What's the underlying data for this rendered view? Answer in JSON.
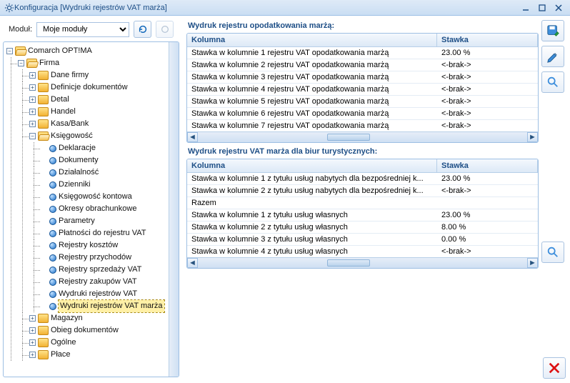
{
  "window": {
    "title": "Konfiguracja [Wydruki rejestrów VAT marża]"
  },
  "modulebar": {
    "label": "Moduł:",
    "selected": "Moje moduły"
  },
  "tree": {
    "root": "Comarch OPT!MA",
    "firma": "Firma",
    "dane_firmy": "Dane firmy",
    "definicje_dok": "Definicje dokumentów",
    "detal": "Detal",
    "handel": "Handel",
    "kasa_bank": "Kasa/Bank",
    "ksiegowosc": "Księgowość",
    "deklaracje": "Deklaracje",
    "dokumenty": "Dokumenty",
    "dzialalnosc": "Działalność",
    "dzienniki": "Dzienniki",
    "ksieg_kontowa": "Księgowość kontowa",
    "okresy": "Okresy obrachunkowe",
    "parametry": "Parametry",
    "platnosci": "Płatności do rejestru VAT",
    "rej_kosztow": "Rejestry kosztów",
    "rej_przych": "Rejestry przychodów",
    "rej_sprzed": "Rejestry sprzedaży VAT",
    "rej_zak": "Rejestry zakupów VAT",
    "wydruki_vat": "Wydruki rejestrów VAT",
    "wydruki_vat_m": "Wydruki rejestrów VAT marża",
    "magazyn": "Magazyn",
    "obieg": "Obieg dokumentów",
    "ogolne": "Ogólne",
    "place": "Płace"
  },
  "panel1": {
    "title": "Wydruk rejestru opodatkowania marżą:",
    "col_a": "Kolumna",
    "col_b": "Stawka",
    "rows": [
      {
        "a": "Stawka w kolumnie 1 rejestru VAT opodatkowania marżą",
        "b": "23.00 %"
      },
      {
        "a": "Stawka w kolumnie 2 rejestru VAT opodatkowania marżą",
        "b": "<-brak->"
      },
      {
        "a": "Stawka w kolumnie 3 rejestru VAT opodatkowania marżą",
        "b": "<-brak->"
      },
      {
        "a": "Stawka w kolumnie 4 rejestru VAT opodatkowania marżą",
        "b": "<-brak->"
      },
      {
        "a": "Stawka w kolumnie 5 rejestru VAT opodatkowania marżą",
        "b": "<-brak->"
      },
      {
        "a": "Stawka w kolumnie 6 rejestru VAT opodatkowania marżą",
        "b": "<-brak->"
      },
      {
        "a": "Stawka w kolumnie 7 rejestru VAT opodatkowania marżą",
        "b": "<-brak->"
      }
    ]
  },
  "panel2": {
    "title": "Wydruk rejestru VAT marża dla biur turystycznych:",
    "col_a": "Kolumna",
    "col_b": "Stawka",
    "rows": [
      {
        "a": "Stawka w kolumnie 1 z tytułu usług nabytych dla bezpośredniej k...",
        "b": "23.00 %"
      },
      {
        "a": "Stawka w kolumnie 2 z tytułu usług nabytych dla bezpośredniej k...",
        "b": "<-brak->"
      },
      {
        "a": "Razem",
        "b": ""
      },
      {
        "a": "Stawka w kolumnie 1 z tytułu usług własnych",
        "b": "23.00 %"
      },
      {
        "a": "Stawka w kolumnie 2 z tytułu usług własnych",
        "b": "8.00  %"
      },
      {
        "a": "Stawka w kolumnie 3 z tytułu usług własnych",
        "b": "0.00  %"
      },
      {
        "a": "Stawka w kolumnie 4 z tytułu usług własnych",
        "b": "<-brak->"
      }
    ]
  }
}
